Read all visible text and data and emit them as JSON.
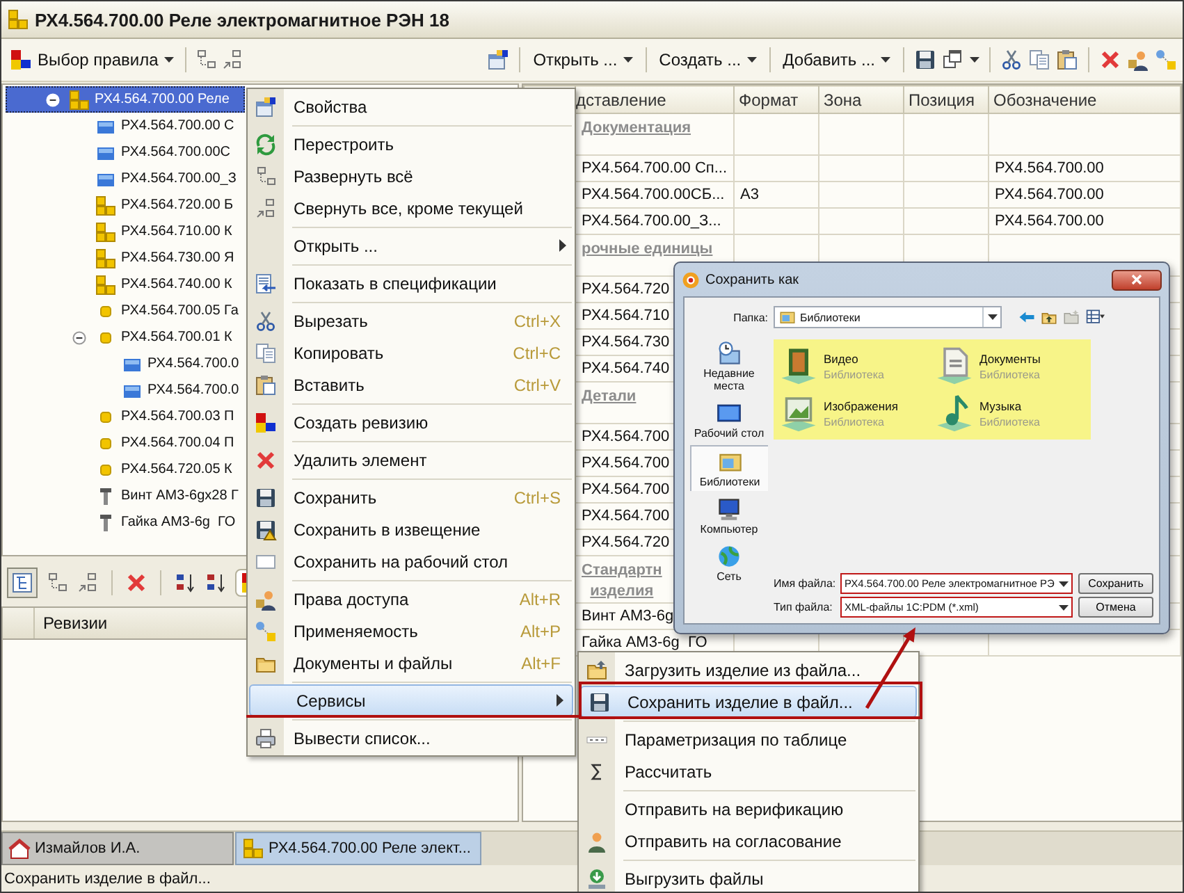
{
  "window": {
    "title": "РХ4.564.700.00 Реле электромагнитное РЭН 18"
  },
  "toolbar": {
    "rule_menu": "Выбор правила",
    "menus": [
      "Открыть ...",
      "Создать ...",
      "Добавить ..."
    ]
  },
  "tree": [
    {
      "label": "РХ4.564.700.00 Реле",
      "kind": "assembly",
      "selected": true,
      "expanded": true,
      "children": [
        {
          "label": "РХ4.564.700.00 С",
          "kind": "document",
          "selected": false
        },
        {
          "label": "РХ4.564.700.00С",
          "kind": "document",
          "selected": false
        },
        {
          "label": "РХ4.564.700.00_З",
          "kind": "document",
          "selected": false
        },
        {
          "label": "РХ4.564.720.00 Б",
          "kind": "assembly",
          "selected": false
        },
        {
          "label": "РХ4.564.710.00 К",
          "kind": "assembly",
          "selected": false
        },
        {
          "label": "РХ4.564.730.00 Я",
          "kind": "assembly",
          "selected": false
        },
        {
          "label": "РХ4.564.740.00 К",
          "kind": "assembly",
          "selected": false
        },
        {
          "label": "РХ4.564.700.05 Га",
          "kind": "part",
          "selected": false
        },
        {
          "label": "РХ4.564.700.01 К",
          "kind": "part",
          "selected": false,
          "expanded": true,
          "children": [
            {
              "label": "РХ4.564.700.0",
              "kind": "document",
              "selected": false
            },
            {
              "label": "РХ4.564.700.0",
              "kind": "document",
              "selected": false
            }
          ]
        },
        {
          "label": "РХ4.564.700.03 П",
          "kind": "part",
          "selected": false
        },
        {
          "label": "РХ4.564.700.04 П",
          "kind": "part",
          "selected": false
        },
        {
          "label": "РХ4.564.720.05 К",
          "kind": "part",
          "selected": false
        },
        {
          "label": "Винт АМ3-6gx28 Г",
          "kind": "standard",
          "selected": false
        },
        {
          "label": "Гайка АМ3-6g  ГО",
          "kind": "standard",
          "selected": false
        }
      ]
    }
  ],
  "revisions": {
    "columns": [
      "Ревизии"
    ]
  },
  "spec_table": {
    "columns": [
      "дставление",
      "Формат",
      "Зона",
      "Позиция",
      "Обозначение"
    ],
    "rows": [
      {
        "kind": "group",
        "label": "Документация"
      },
      {
        "kind": "item",
        "name": "РХ4.564.700.00 Сп...",
        "designation": "РХ4.564.700.00"
      },
      {
        "kind": "item",
        "name": "РХ4.564.700.00СБ...",
        "format": "А3",
        "designation": "РХ4.564.700.00"
      },
      {
        "kind": "item",
        "name": "РХ4.564.700.00_З...",
        "designation": "РХ4.564.700.00"
      },
      {
        "kind": "group",
        "label": "рочные единицы"
      },
      {
        "kind": "item",
        "name": "РХ4.564.720"
      },
      {
        "kind": "item",
        "name": "РХ4.564.710"
      },
      {
        "kind": "item",
        "name": "РХ4.564.730"
      },
      {
        "kind": "item",
        "name": "РХ4.564.740"
      },
      {
        "kind": "group",
        "label": "Детали"
      },
      {
        "kind": "item",
        "name": "РХ4.564.700"
      },
      {
        "kind": "item",
        "name": "РХ4.564.700"
      },
      {
        "kind": "item",
        "name": "РХ4.564.700"
      },
      {
        "kind": "item",
        "name": "РХ4.564.700"
      },
      {
        "kind": "item",
        "name": "РХ4.564.720"
      },
      {
        "kind": "group",
        "label": "Стандартн\nизделия"
      },
      {
        "kind": "item",
        "name": "Винт АМ3-6g"
      },
      {
        "kind": "item",
        "name": "Гайка АМ3-6g  ГО"
      }
    ]
  },
  "context_menu": {
    "items": [
      {
        "kind": "item",
        "label": "Свойства",
        "selected": false
      },
      {
        "kind": "separator"
      },
      {
        "kind": "item",
        "label": "Перестроить",
        "selected": false
      },
      {
        "kind": "item",
        "label": "Развернуть всё",
        "selected": false
      },
      {
        "kind": "item",
        "label": "Свернуть все, кроме текущей",
        "selected": false
      },
      {
        "kind": "separator"
      },
      {
        "kind": "submenu",
        "label": "Открыть ...",
        "selected": false
      },
      {
        "kind": "separator"
      },
      {
        "kind": "item",
        "label": "Показать в спецификации",
        "selected": false
      },
      {
        "kind": "separator"
      },
      {
        "kind": "item",
        "label": "Вырезать",
        "shortcut": "Ctrl+X",
        "selected": false
      },
      {
        "kind": "item",
        "label": "Копировать",
        "shortcut": "Ctrl+C",
        "selected": false
      },
      {
        "kind": "item",
        "label": "Вставить",
        "shortcut": "Ctrl+V",
        "selected": false
      },
      {
        "kind": "separator"
      },
      {
        "kind": "item",
        "label": "Создать ревизию",
        "selected": false
      },
      {
        "kind": "separator"
      },
      {
        "kind": "item",
        "label": "Удалить элемент",
        "selected": false
      },
      {
        "kind": "separator"
      },
      {
        "kind": "item",
        "label": "Сохранить",
        "shortcut": "Ctrl+S",
        "selected": false
      },
      {
        "kind": "item",
        "label": "Сохранить в извещение",
        "selected": false
      },
      {
        "kind": "item",
        "label": "Сохранить на рабочий стол",
        "selected": false
      },
      {
        "kind": "separator"
      },
      {
        "kind": "item",
        "label": "Права доступа",
        "shortcut": "Alt+R",
        "selected": false
      },
      {
        "kind": "item",
        "label": "Применяемость",
        "shortcut": "Alt+P",
        "selected": false
      },
      {
        "kind": "item",
        "label": "Документы и файлы",
        "shortcut": "Alt+F",
        "selected": false
      },
      {
        "kind": "separator"
      },
      {
        "kind": "submenu",
        "label": "Сервисы",
        "selected": true
      },
      {
        "kind": "separator"
      },
      {
        "kind": "item",
        "label": "Вывести список...",
        "selected": false
      }
    ]
  },
  "submenu": {
    "items": [
      {
        "kind": "item",
        "label": "Загрузить изделие из файла...",
        "selected": false
      },
      {
        "kind": "item",
        "label": "Сохранить изделие в файл...",
        "selected": true
      },
      {
        "kind": "separator"
      },
      {
        "kind": "item",
        "label": "Параметризация по таблице",
        "selected": false
      },
      {
        "kind": "item",
        "label": "Рассчитать",
        "selected": false
      },
      {
        "kind": "separator"
      },
      {
        "kind": "item",
        "label": "Отправить на верификацию",
        "selected": false
      },
      {
        "kind": "item",
        "label": "Отправить на согласование",
        "selected": false
      },
      {
        "kind": "separator"
      },
      {
        "kind": "item",
        "label": "Выгрузить файлы",
        "selected": false
      }
    ]
  },
  "save_dialog": {
    "title": "Сохранить как",
    "folder_label": "Папка:",
    "folder": "Библиотеки",
    "places": [
      {
        "label": "Недавние места",
        "selected": false
      },
      {
        "label": "Рабочий стол",
        "selected": false
      },
      {
        "label": "Библиотеки",
        "selected": true
      },
      {
        "label": "Компьютер",
        "selected": false
      },
      {
        "label": "Сеть",
        "selected": false
      }
    ],
    "libraries": [
      {
        "name": "Видео",
        "type": "Библиотека"
      },
      {
        "name": "Документы",
        "type": "Библиотека"
      },
      {
        "name": "Изображения",
        "type": "Библиотека"
      },
      {
        "name": "Музыка",
        "type": "Библиотека"
      }
    ],
    "file_name_label": "Имя файла:",
    "file_name": "РХ4.564.700.00 Реле электромагнитное РЭ",
    "file_type_label": "Тип файла:",
    "file_type": "XML-файлы 1C:PDM (*.xml)",
    "buttons": [
      "Сохранить",
      "Отмена"
    ]
  },
  "taskbar": [
    {
      "label": "Измайлов И.А.",
      "selected": false
    },
    {
      "label": "РХ4.564.700.00 Реле элект...",
      "selected": true
    }
  ],
  "status_bar": "Сохранить изделие в файл..."
}
